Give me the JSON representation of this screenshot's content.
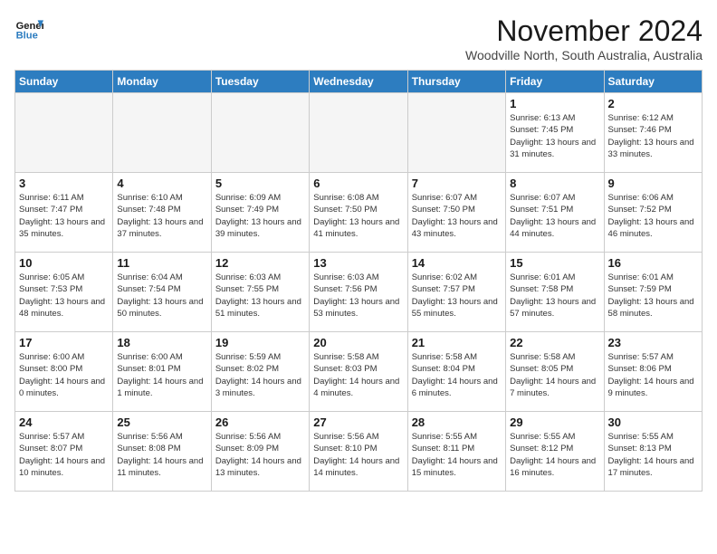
{
  "header": {
    "logo_line1": "General",
    "logo_line2": "Blue",
    "month": "November 2024",
    "location": "Woodville North, South Australia, Australia"
  },
  "days_of_week": [
    "Sunday",
    "Monday",
    "Tuesday",
    "Wednesday",
    "Thursday",
    "Friday",
    "Saturday"
  ],
  "weeks": [
    [
      {
        "day": "",
        "info": ""
      },
      {
        "day": "",
        "info": ""
      },
      {
        "day": "",
        "info": ""
      },
      {
        "day": "",
        "info": ""
      },
      {
        "day": "",
        "info": ""
      },
      {
        "day": "1",
        "info": "Sunrise: 6:13 AM\nSunset: 7:45 PM\nDaylight: 13 hours\nand 31 minutes."
      },
      {
        "day": "2",
        "info": "Sunrise: 6:12 AM\nSunset: 7:46 PM\nDaylight: 13 hours\nand 33 minutes."
      }
    ],
    [
      {
        "day": "3",
        "info": "Sunrise: 6:11 AM\nSunset: 7:47 PM\nDaylight: 13 hours\nand 35 minutes."
      },
      {
        "day": "4",
        "info": "Sunrise: 6:10 AM\nSunset: 7:48 PM\nDaylight: 13 hours\nand 37 minutes."
      },
      {
        "day": "5",
        "info": "Sunrise: 6:09 AM\nSunset: 7:49 PM\nDaylight: 13 hours\nand 39 minutes."
      },
      {
        "day": "6",
        "info": "Sunrise: 6:08 AM\nSunset: 7:50 PM\nDaylight: 13 hours\nand 41 minutes."
      },
      {
        "day": "7",
        "info": "Sunrise: 6:07 AM\nSunset: 7:50 PM\nDaylight: 13 hours\nand 43 minutes."
      },
      {
        "day": "8",
        "info": "Sunrise: 6:07 AM\nSunset: 7:51 PM\nDaylight: 13 hours\nand 44 minutes."
      },
      {
        "day": "9",
        "info": "Sunrise: 6:06 AM\nSunset: 7:52 PM\nDaylight: 13 hours\nand 46 minutes."
      }
    ],
    [
      {
        "day": "10",
        "info": "Sunrise: 6:05 AM\nSunset: 7:53 PM\nDaylight: 13 hours\nand 48 minutes."
      },
      {
        "day": "11",
        "info": "Sunrise: 6:04 AM\nSunset: 7:54 PM\nDaylight: 13 hours\nand 50 minutes."
      },
      {
        "day": "12",
        "info": "Sunrise: 6:03 AM\nSunset: 7:55 PM\nDaylight: 13 hours\nand 51 minutes."
      },
      {
        "day": "13",
        "info": "Sunrise: 6:03 AM\nSunset: 7:56 PM\nDaylight: 13 hours\nand 53 minutes."
      },
      {
        "day": "14",
        "info": "Sunrise: 6:02 AM\nSunset: 7:57 PM\nDaylight: 13 hours\nand 55 minutes."
      },
      {
        "day": "15",
        "info": "Sunrise: 6:01 AM\nSunset: 7:58 PM\nDaylight: 13 hours\nand 57 minutes."
      },
      {
        "day": "16",
        "info": "Sunrise: 6:01 AM\nSunset: 7:59 PM\nDaylight: 13 hours\nand 58 minutes."
      }
    ],
    [
      {
        "day": "17",
        "info": "Sunrise: 6:00 AM\nSunset: 8:00 PM\nDaylight: 14 hours\nand 0 minutes."
      },
      {
        "day": "18",
        "info": "Sunrise: 6:00 AM\nSunset: 8:01 PM\nDaylight: 14 hours\nand 1 minute."
      },
      {
        "day": "19",
        "info": "Sunrise: 5:59 AM\nSunset: 8:02 PM\nDaylight: 14 hours\nand 3 minutes."
      },
      {
        "day": "20",
        "info": "Sunrise: 5:58 AM\nSunset: 8:03 PM\nDaylight: 14 hours\nand 4 minutes."
      },
      {
        "day": "21",
        "info": "Sunrise: 5:58 AM\nSunset: 8:04 PM\nDaylight: 14 hours\nand 6 minutes."
      },
      {
        "day": "22",
        "info": "Sunrise: 5:58 AM\nSunset: 8:05 PM\nDaylight: 14 hours\nand 7 minutes."
      },
      {
        "day": "23",
        "info": "Sunrise: 5:57 AM\nSunset: 8:06 PM\nDaylight: 14 hours\nand 9 minutes."
      }
    ],
    [
      {
        "day": "24",
        "info": "Sunrise: 5:57 AM\nSunset: 8:07 PM\nDaylight: 14 hours\nand 10 minutes."
      },
      {
        "day": "25",
        "info": "Sunrise: 5:56 AM\nSunset: 8:08 PM\nDaylight: 14 hours\nand 11 minutes."
      },
      {
        "day": "26",
        "info": "Sunrise: 5:56 AM\nSunset: 8:09 PM\nDaylight: 14 hours\nand 13 minutes."
      },
      {
        "day": "27",
        "info": "Sunrise: 5:56 AM\nSunset: 8:10 PM\nDaylight: 14 hours\nand 14 minutes."
      },
      {
        "day": "28",
        "info": "Sunrise: 5:55 AM\nSunset: 8:11 PM\nDaylight: 14 hours\nand 15 minutes."
      },
      {
        "day": "29",
        "info": "Sunrise: 5:55 AM\nSunset: 8:12 PM\nDaylight: 14 hours\nand 16 minutes."
      },
      {
        "day": "30",
        "info": "Sunrise: 5:55 AM\nSunset: 8:13 PM\nDaylight: 14 hours\nand 17 minutes."
      }
    ]
  ]
}
